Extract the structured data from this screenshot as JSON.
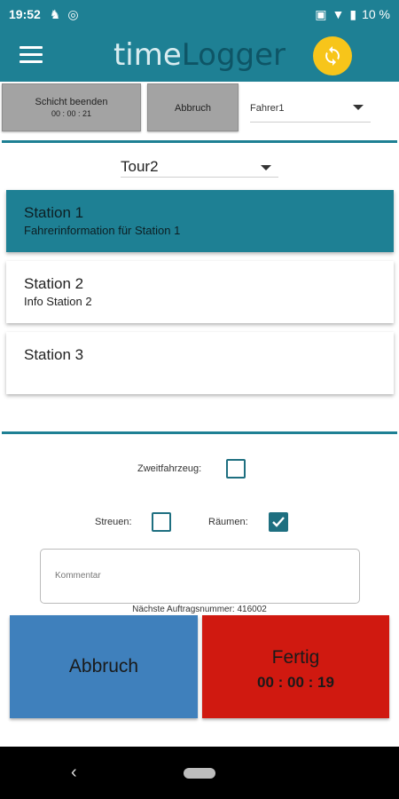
{
  "status_bar": {
    "time": "19:52",
    "battery": "10 %"
  },
  "app_bar": {
    "title_part1": "time",
    "title_part2": "Logger"
  },
  "shift": {
    "end_label": "Schicht beenden",
    "timer": "00 : 00 : 21",
    "abort_label": "Abbruch"
  },
  "driver": {
    "selected": "Fahrer1"
  },
  "tour": {
    "selected": "Tour2"
  },
  "stations": [
    {
      "name": "Station 1",
      "info": "Fahrerinformation für Station 1",
      "active": true
    },
    {
      "name": "Station 2",
      "info": "Info Station 2",
      "active": false
    },
    {
      "name": "Station 3",
      "info": "",
      "active": false
    }
  ],
  "options": {
    "second_vehicle_label": "Zweitfahrzeug:",
    "second_vehicle_checked": false,
    "spread_label": "Streuen:",
    "spread_checked": false,
    "clear_label": "Räumen:",
    "clear_checked": true
  },
  "comment": {
    "placeholder": "Kommentar"
  },
  "next_order": "Nächste Auftragsnummer: 416002",
  "actions": {
    "abort_label": "Abbruch",
    "done_label": "Fertig",
    "done_timer": "00 : 00 : 19"
  },
  "colors": {
    "primary": "#1e8094",
    "accent": "#f7c51a",
    "abort": "#3f80bc",
    "done": "#d01910"
  }
}
